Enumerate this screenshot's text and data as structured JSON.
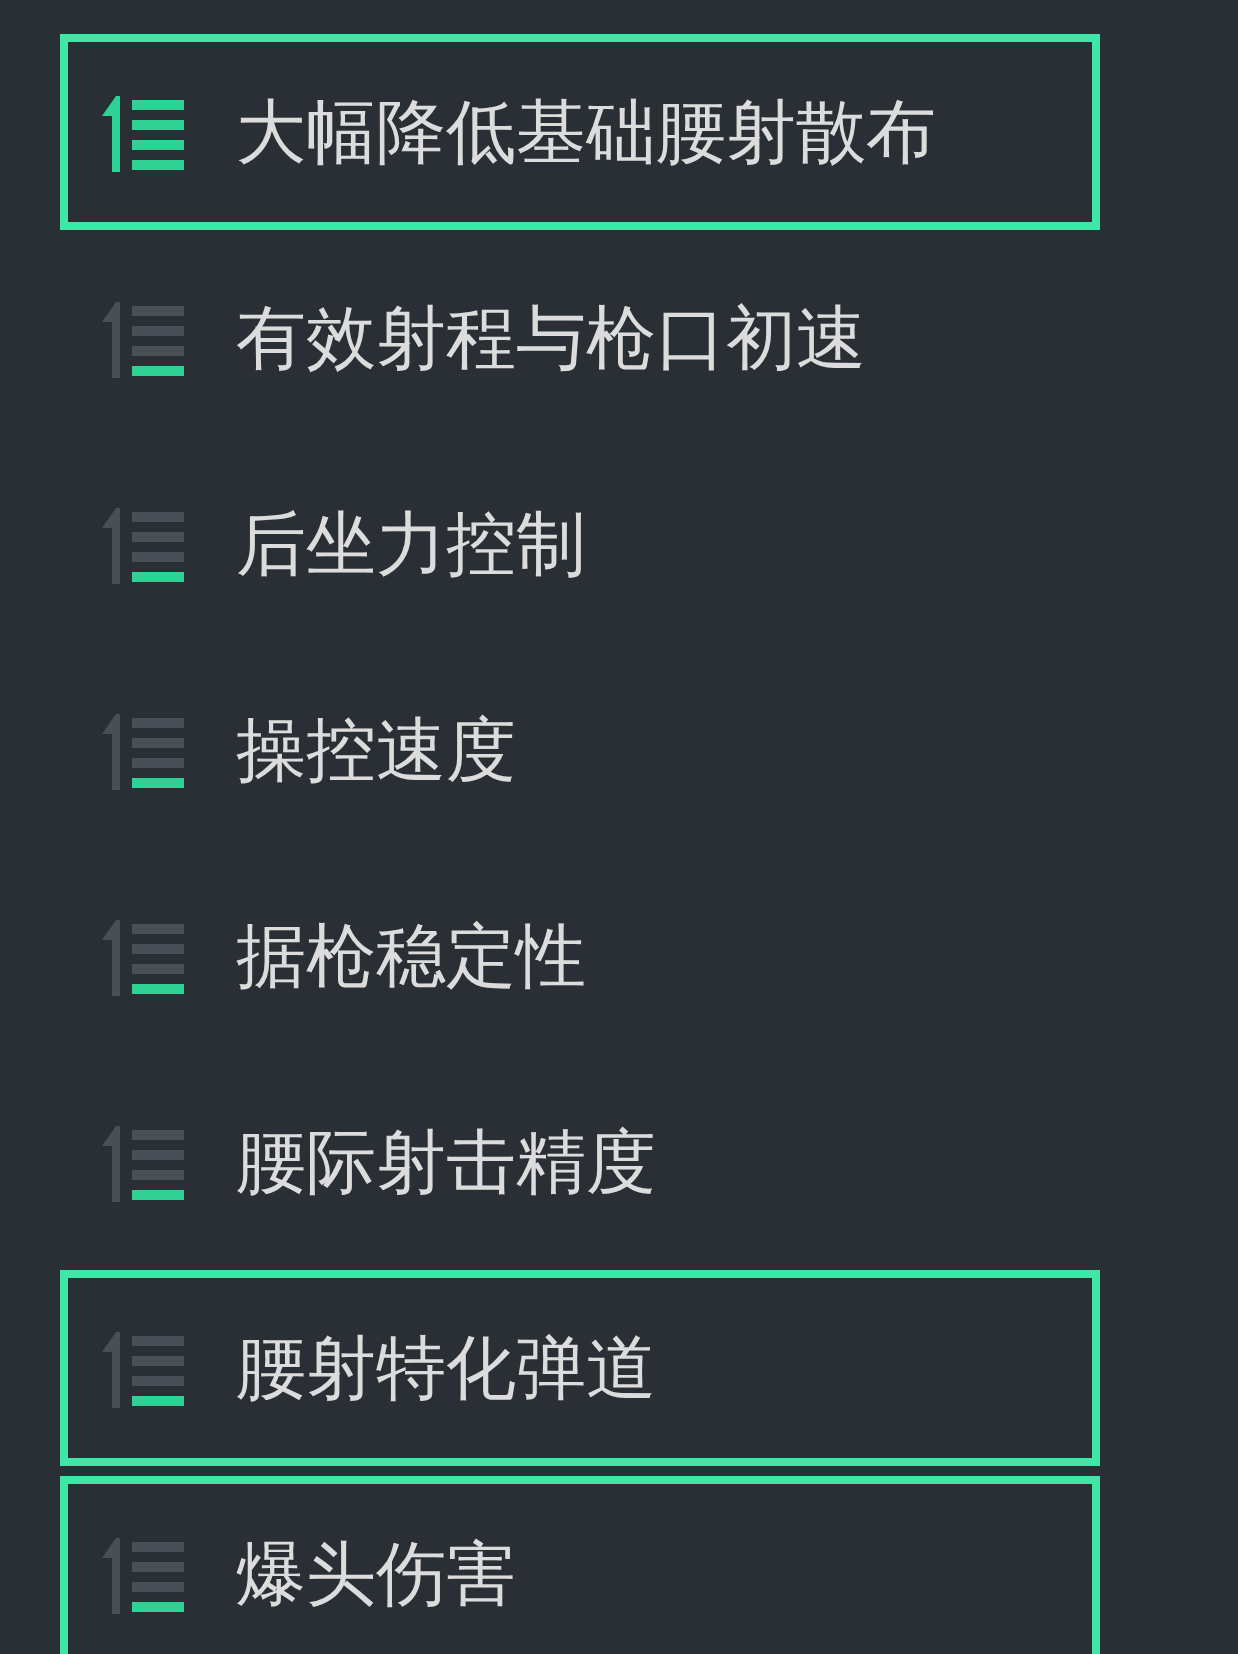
{
  "items": [
    {
      "label": "大幅降低基础腰射散布",
      "selected": true,
      "upgraded": true
    },
    {
      "label": "有效射程与枪口初速",
      "selected": false,
      "upgraded": false
    },
    {
      "label": "后坐力控制",
      "selected": false,
      "upgraded": false
    },
    {
      "label": "操控速度",
      "selected": false,
      "upgraded": false
    },
    {
      "label": "据枪稳定性",
      "selected": false,
      "upgraded": false
    },
    {
      "label": "腰际射击精度",
      "selected": false,
      "upgraded": false
    },
    {
      "label": "腰射特化弹道",
      "selected": true,
      "upgraded": false
    },
    {
      "label": "爆头伤害",
      "selected": true,
      "upgraded": false
    }
  ]
}
